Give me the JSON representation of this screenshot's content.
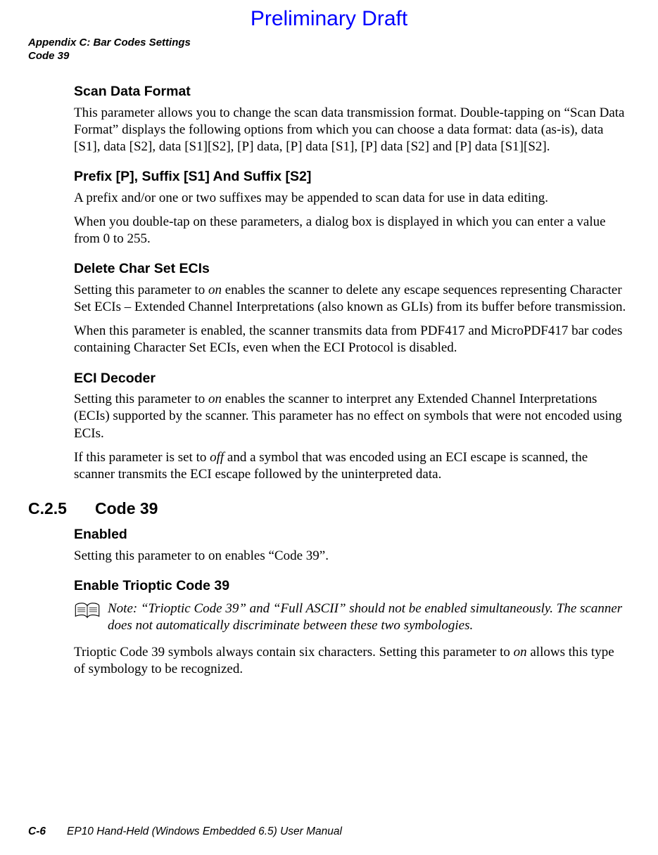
{
  "draft_label": "Preliminary Draft",
  "running_head": {
    "line1": "Appendix C: Bar Codes Settings",
    "line2": "Code 39"
  },
  "sections": {
    "scan_data_format": {
      "heading": "Scan Data Format",
      "p1": "This parameter allows you to change the scan data transmission format. Double-tapping on “Scan Data Format” displays the following options from which you can choose a data format: data (as-is), data [S1], data [S2], data [S1][S2], [P] data, [P] data [S1], [P] data [S2] and [P] data [S1][S2]."
    },
    "prefix_suffix": {
      "heading": "Prefix [P], Suffix [S1] And Suffix [S2]",
      "p1": "A prefix and/or one or two suffixes may be appended to scan data for use in data editing.",
      "p2": "When you double-tap on these parameters, a dialog box is displayed in which you can enter a value from 0 to 255."
    },
    "delete_char_set": {
      "heading": "Delete Char Set ECIs",
      "p1_a": "Setting this parameter to ",
      "p1_on": "on",
      "p1_b": " enables the scanner to delete any escape sequences representing Character Set ECIs – Extended Channel Interpretations (also known as GLIs) from its buffer before transmission.",
      "p2": "When this parameter is enabled, the scanner transmits data from PDF417 and MicroPDF417 bar codes containing Character Set ECIs, even when the ECI Protocol is disabled."
    },
    "eci_decoder": {
      "heading": "ECI Decoder",
      "p1_a": "Setting this parameter to ",
      "p1_on": "on",
      "p1_b": " enables the scanner to interpret any Extended Channel Interpretations (ECIs) supported by the scanner. This parameter has no effect on symbols that were not encoded using ECIs.",
      "p2_a": "If this parameter is set to ",
      "p2_off": "off",
      "p2_b": " and a symbol that was encoded using an ECI escape is scanned, the scanner transmits the ECI escape followed by the uninterpreted data."
    },
    "code39": {
      "number": "C.2.5",
      "title": "Code 39",
      "enabled_heading": "Enabled",
      "enabled_p": "Setting this parameter to on enables “Code 39”.",
      "trioptic_heading": "Enable Trioptic Code 39",
      "note_label": "Note: ",
      "note_text": "“Trioptic Code 39” and “Full ASCII” should not be enabled simultaneously. The scanner does not automatically discriminate between these two symbologies.",
      "trioptic_p_a": "Trioptic Code 39 symbols always contain six characters. Setting this parameter to ",
      "trioptic_on": "on",
      "trioptic_p_b": " allows this type of symbology to be recognized."
    }
  },
  "footer": {
    "page": "C-6",
    "manual": "EP10 Hand-Held (Windows Embedded 6.5) User Manual"
  }
}
